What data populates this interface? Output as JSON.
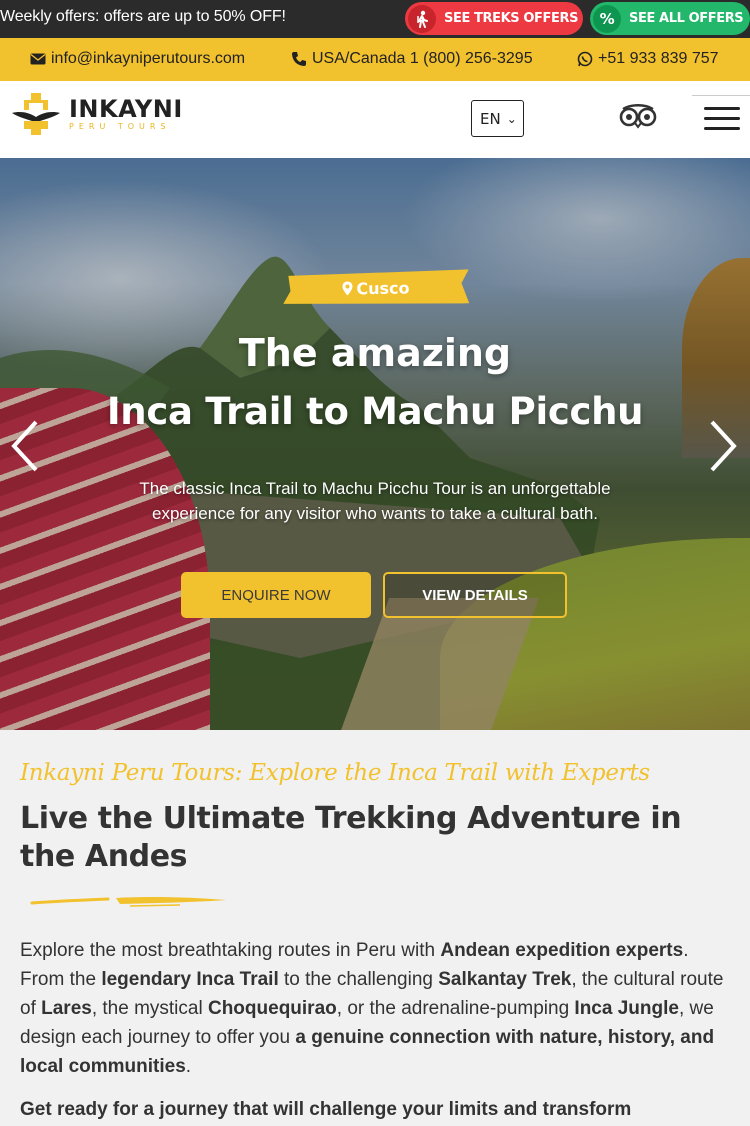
{
  "offers_bar": {
    "text": "Weekly offers: offers are up to 50% OFF!",
    "treks_button": "SEE TREKS OFFERS",
    "all_offers_button": "SEE ALL OFFERS",
    "all_offers_icon_glyph": "%",
    "treks_color": "#ec3942",
    "all_offers_color": "#22b76a"
  },
  "contact": {
    "email": "info@inkayniperutours.com",
    "phone": "USA/Canada 1 (800) 256-3295",
    "whatsapp": "+51 933 839 757",
    "bar_color": "#f2c12e"
  },
  "header": {
    "logo_name": "INKAYNI",
    "logo_sub": "PERU TOURS",
    "language": "EN",
    "icons": [
      "tripadvisor-icon",
      "hamburger-menu-icon"
    ]
  },
  "hero": {
    "location": "Cusco",
    "title_line1": "The amazing",
    "title_line2": "Inca Trail to Machu Picchu",
    "description": "The classic Inca Trail to Machu Picchu Tour is an unforgettable experience for any visitor who wants to take a cultural bath.",
    "enquire_button": "ENQUIRE NOW",
    "details_button": "VIEW DETAILS",
    "accent_color": "#f2c12e"
  },
  "content": {
    "tagline": "Inkayni Peru Tours: Explore the Inca Trail with Experts",
    "heading": "Live the Ultimate Trekking Adventure in the Andes",
    "intro_parts": [
      {
        "t": "Explore the most breathtaking routes in Peru with ",
        "b": false
      },
      {
        "t": "Andean expedition experts",
        "b": true
      },
      {
        "t": ". From the ",
        "b": false
      },
      {
        "t": "legendary Inca Trail",
        "b": true
      },
      {
        "t": " to the challenging ",
        "b": false
      },
      {
        "t": "Salkantay Trek",
        "b": true
      },
      {
        "t": ", the cultural route of ",
        "b": false
      },
      {
        "t": "Lares",
        "b": true
      },
      {
        "t": ", the mystical ",
        "b": false
      },
      {
        "t": "Choquequirao",
        "b": true
      },
      {
        "t": ", or the adrenaline-pumping ",
        "b": false
      },
      {
        "t": "Inca Jungle",
        "b": true
      },
      {
        "t": ", we design each journey to offer you ",
        "b": false
      },
      {
        "t": "a genuine connection with nature, history, and local communities",
        "b": true
      },
      {
        "t": ".",
        "b": false
      }
    ],
    "intro2": "Get ready for a journey that will challenge your limits and transform"
  }
}
